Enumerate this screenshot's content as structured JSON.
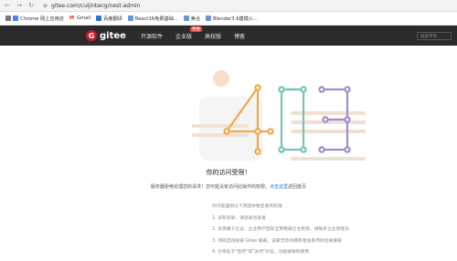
{
  "browser": {
    "url": "gitee.com/cuijinteng/nest-admin",
    "back_icon": "arrow-left-icon",
    "forward_icon": "arrow-right-icon",
    "reload_icon": "reload-icon"
  },
  "bookmarks": [
    {
      "label": "Chrome 网上应用店",
      "icon": "chrome-icon"
    },
    {
      "label": "Gmail",
      "icon": "gmail-icon"
    },
    {
      "label": "百度翻译",
      "icon": "translate-icon"
    },
    {
      "label": "React16免费基础...",
      "icon": "folder-icon"
    },
    {
      "label": "美合",
      "icon": "folder-icon"
    },
    {
      "label": "Blender3.6建模入...",
      "icon": "folder-icon"
    }
  ],
  "topnav": {
    "logo_letter": "G",
    "logo_text": "gitee",
    "links": [
      "开源软件",
      "企业版",
      "高校版",
      "博客"
    ],
    "enterprise_badge": "特惠",
    "search_placeholder": "搜索项目",
    "brand_color": "#c71d23"
  },
  "page": {
    "title": "你的访问受限！",
    "subtitle_before": "服务器拒绝处理您的请求！您可能没有访问此操作的权限，",
    "subtitle_link": "点击这里",
    "subtitle_after": "返回首页",
    "reasons_heading": "你可能遇到以下原因导致您受到权限",
    "reasons": [
      "1. 没有登录，请登录后查看",
      "2. 资源属于企业，企业用户因安全策略被企业拒绝，请联系企业管理员",
      "3. 项目因违规被 Gitee 屏蔽，该聚无项目拥有者查看项目后被屏蔽",
      "4. 仓库处于\"暂停\"或\"关闭\"状态，功能被限制使用"
    ],
    "error_code": "403"
  }
}
